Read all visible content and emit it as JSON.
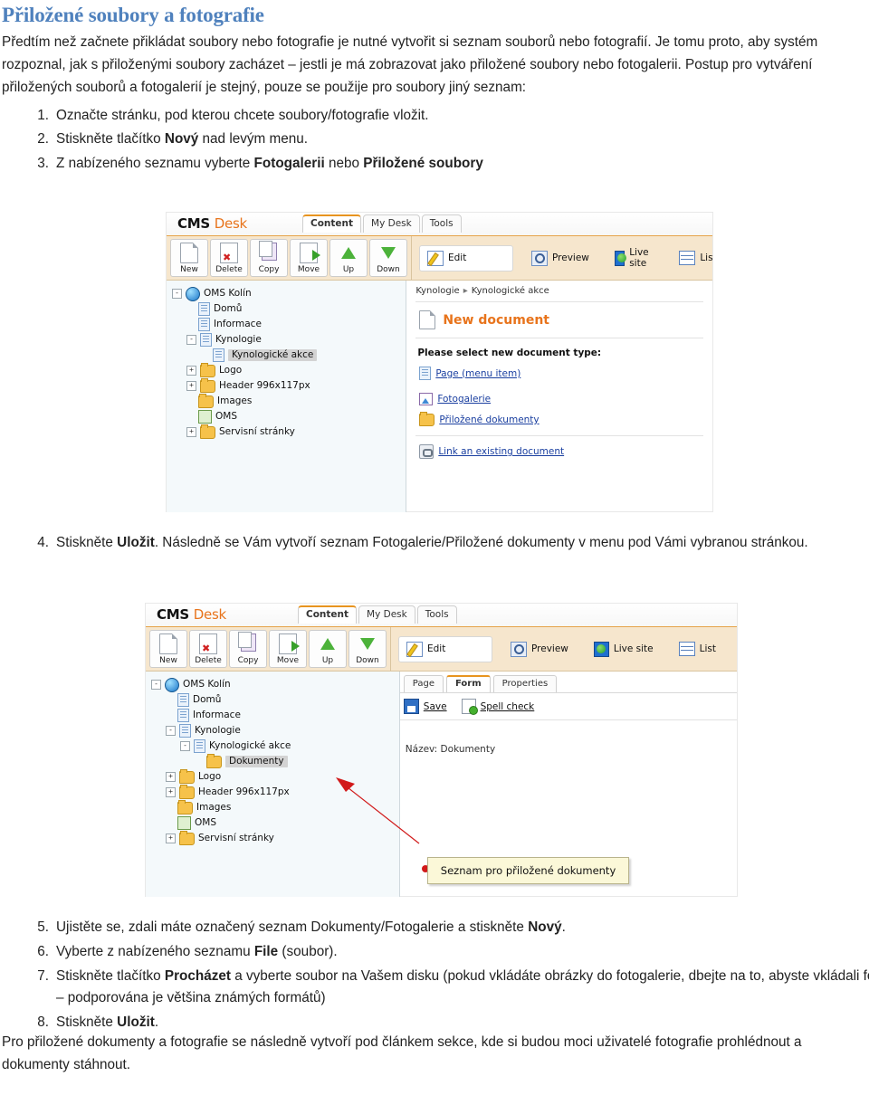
{
  "doc": {
    "title": "Přiložené soubory a fotografie",
    "intro": [
      "Předtím než začnete přikládat soubory nebo fotografie je nutné vytvořit si seznam souborů nebo fotografií. Je tomu proto, aby systém rozpoznal, jak s přiloženými soubory zacházet – jestli je má zobrazovat jako přiložené soubory nebo fotogalerii. Postup pro vytváření přiložených souborů a fotogalerií je stejný, pouze se použije pro soubory jiný seznam:"
    ],
    "steps_first": [
      {
        "num": "1.",
        "text_before": "Označte stránku, pod kterou chcete soubory/fotografie vložit.",
        "bold": "",
        "text_after": ""
      },
      {
        "num": "2.",
        "text_before": "Stiskněte tlačítko ",
        "bold": "Nový",
        "text_after": " nad levým menu."
      },
      {
        "num": "3.",
        "text_before": "Z nabízeného seznamu vyberte ",
        "bold": "Fotogalerii",
        "text_after": " nebo ",
        "bold2": "Přiložené soubory",
        "text_after2": ""
      }
    ],
    "step4": {
      "num": "4.",
      "text_before": "Stiskněte ",
      "bold": "Uložit",
      "text_after": ". Následně se Vám vytvoří seznam Fotogalerie/Přiložené dokumenty v menu pod Vámi vybranou stránkou."
    },
    "steps_last": [
      {
        "num": "5.",
        "text_before": "Ujistěte se, zdali máte označený seznam Dokumenty/Fotogalerie a stiskněte ",
        "bold": "Nový",
        "text_after": "."
      },
      {
        "num": "6.",
        "text_before": "Vyberte z nabízeného seznamu ",
        "bold": "File",
        "text_after": " (soubor)."
      },
      {
        "num": "7.",
        "text_before": "Stiskněte tlačítko ",
        "bold": "Procházet",
        "text_after": " a vyberte soubor na Vašem disku (pokud vkládáte obrázky do fotogalerie, dbejte na to, abyste vkládali fotografie – podporována je většina známých formátů)"
      },
      {
        "num": "8.",
        "text_before": "Stiskněte ",
        "bold": "Uložit",
        "text_after": "."
      }
    ],
    "outro": "Pro přiložené dokumenty a fotografie se následně vytvoří pod článkem sekce, kde si budou moci uživatelé fotografie prohlédnout a dokumenty stáhnout."
  },
  "colors": {
    "heading": "#4f81bd",
    "cms_orange": "#e8741c",
    "toolbar_bg": "#f6e6cd",
    "tree_bg": "#f4f9fb",
    "link": "#1a3fa0",
    "callout_bg": "#fbf8d8",
    "annotation_red": "#d11a1a"
  },
  "shot1": {
    "brand_c": "CMS",
    "brand_d": "Desk",
    "tabs": [
      {
        "label": "Content",
        "active": true
      },
      {
        "label": "My Desk",
        "active": false
      },
      {
        "label": "Tools",
        "active": false
      }
    ],
    "toolbar_left": [
      {
        "label": "New",
        "icon": "new-document-icon"
      },
      {
        "label": "Delete",
        "icon": "delete-document-icon"
      },
      {
        "label": "Copy",
        "icon": "copy-icon"
      },
      {
        "label": "Move",
        "icon": "move-icon"
      },
      {
        "label": "Up",
        "icon": "arrow-up-icon"
      },
      {
        "label": "Down",
        "icon": "arrow-down-icon"
      }
    ],
    "toolbar_right": [
      {
        "label": "Edit",
        "icon": "edit-icon"
      },
      {
        "label": "Preview",
        "icon": "preview-magnifier-icon"
      },
      {
        "label": "Live site",
        "icon": "live-site-globe-icon"
      },
      {
        "label": "List",
        "icon": "list-icon"
      }
    ],
    "tree": [
      {
        "label": "OMS Kolín",
        "indent": 0,
        "toggle": "-",
        "icon": "globe-icon",
        "selected": false
      },
      {
        "label": "Domů",
        "indent": 1,
        "toggle": "",
        "icon": "page-icon",
        "selected": false
      },
      {
        "label": "Informace",
        "indent": 1,
        "toggle": "",
        "icon": "page-icon",
        "selected": false
      },
      {
        "label": "Kynologie",
        "indent": 1,
        "toggle": "-",
        "icon": "page-icon",
        "selected": false
      },
      {
        "label": "Kynologické akce",
        "indent": 2,
        "toggle": "",
        "icon": "page-icon",
        "selected": true
      },
      {
        "label": "Logo",
        "indent": 1,
        "toggle": "+",
        "icon": "folder-icon",
        "selected": false
      },
      {
        "label": "Header 996x117px",
        "indent": 1,
        "toggle": "+",
        "icon": "folder-icon",
        "selected": false
      },
      {
        "label": "Images",
        "indent": 1,
        "toggle": "",
        "icon": "folder-icon",
        "selected": false
      },
      {
        "label": "OMS",
        "indent": 1,
        "toggle": "",
        "icon": "oms-icon",
        "selected": false
      },
      {
        "label": "Servisní stránky",
        "indent": 1,
        "toggle": "+",
        "icon": "folder-icon",
        "selected": false
      }
    ],
    "breadcrumb": [
      "Kynologie",
      "Kynologické akce"
    ],
    "breadcrumb_sep": "▸",
    "page_heading": "New document",
    "select_label": "Please select new document type:",
    "doc_types": [
      {
        "label": "Page (menu item)",
        "icon": "page-icon"
      },
      {
        "label": "Fotogalerie",
        "icon": "photo-icon"
      },
      {
        "label": "Přiložené dokumenty",
        "icon": "folder-icon"
      }
    ],
    "link_existing": {
      "label": "Link an existing document",
      "icon": "link-document-icon"
    }
  },
  "shot2": {
    "brand_c": "CMS",
    "brand_d": "Desk",
    "tabs": [
      {
        "label": "Content",
        "active": true
      },
      {
        "label": "My Desk",
        "active": false
      },
      {
        "label": "Tools",
        "active": false
      }
    ],
    "toolbar_left": [
      {
        "label": "New",
        "icon": "new-document-icon"
      },
      {
        "label": "Delete",
        "icon": "delete-document-icon"
      },
      {
        "label": "Copy",
        "icon": "copy-icon"
      },
      {
        "label": "Move",
        "icon": "move-icon"
      },
      {
        "label": "Up",
        "icon": "arrow-up-icon"
      },
      {
        "label": "Down",
        "icon": "arrow-down-icon"
      }
    ],
    "toolbar_right": [
      {
        "label": "Edit",
        "icon": "edit-icon"
      },
      {
        "label": "Preview",
        "icon": "preview-magnifier-icon"
      },
      {
        "label": "Live site",
        "icon": "live-site-globe-icon"
      },
      {
        "label": "List",
        "icon": "list-icon"
      }
    ],
    "tree": [
      {
        "label": "OMS Kolín",
        "indent": 0,
        "toggle": "-",
        "icon": "globe-icon",
        "selected": false
      },
      {
        "label": "Domů",
        "indent": 1,
        "toggle": "",
        "icon": "page-icon",
        "selected": false
      },
      {
        "label": "Informace",
        "indent": 1,
        "toggle": "",
        "icon": "page-icon",
        "selected": false
      },
      {
        "label": "Kynologie",
        "indent": 1,
        "toggle": "-",
        "icon": "page-icon",
        "selected": false
      },
      {
        "label": "Kynologické akce",
        "indent": 2,
        "toggle": "-",
        "icon": "page-icon",
        "selected": false
      },
      {
        "label": "Dokumenty",
        "indent": 3,
        "toggle": "",
        "icon": "folder-icon",
        "selected": true
      },
      {
        "label": "Logo",
        "indent": 1,
        "toggle": "+",
        "icon": "folder-icon",
        "selected": false
      },
      {
        "label": "Header 996x117px",
        "indent": 1,
        "toggle": "+",
        "icon": "folder-icon",
        "selected": false
      },
      {
        "label": "Images",
        "indent": 1,
        "toggle": "",
        "icon": "folder-icon",
        "selected": false
      },
      {
        "label": "OMS",
        "indent": 1,
        "toggle": "",
        "icon": "oms-icon",
        "selected": false
      },
      {
        "label": "Servisní stránky",
        "indent": 1,
        "toggle": "+",
        "icon": "folder-icon",
        "selected": false
      }
    ],
    "form_tabs": [
      {
        "label": "Page",
        "active": false
      },
      {
        "label": "Form",
        "active": true
      },
      {
        "label": "Properties",
        "active": false
      }
    ],
    "form_actions": [
      {
        "label": "Save",
        "icon": "save-icon"
      },
      {
        "label": "Spell check",
        "icon": "spell-check-icon"
      }
    ],
    "field_label": "Název: Dokumenty",
    "callout": "Seznam pro přiložené dokumenty"
  }
}
